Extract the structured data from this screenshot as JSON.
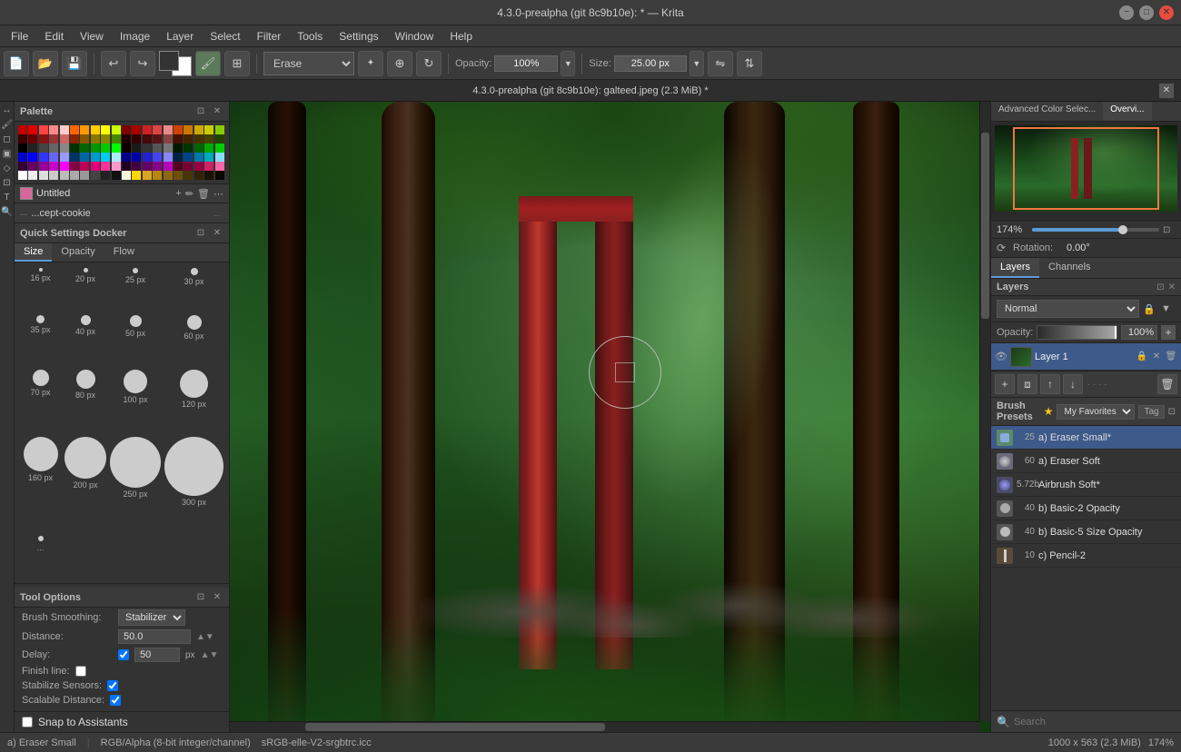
{
  "titlebar": {
    "title": "4.3.0-prealpha (git 8c9b10e):  * — Krita"
  },
  "menubar": {
    "items": [
      "File",
      "Edit",
      "View",
      "Image",
      "Layer",
      "Select",
      "Filter",
      "Tools",
      "Settings",
      "Window",
      "Help"
    ]
  },
  "toolbar": {
    "brush_mode": "Erase",
    "opacity_label": "Opacity:",
    "opacity_value": "100%",
    "size_label": "Size:",
    "size_value": "25.00 px"
  },
  "subheader": {
    "filename": "4.3.0-prealpha (git 8c9b10e): galteed.jpeg (2.3 MiB) *"
  },
  "left_panel": {
    "palette": {
      "title": "Palette",
      "colors": [
        "#c00000",
        "#e00000",
        "#ff4444",
        "#ff8888",
        "#ffcccc",
        "#ff6600",
        "#ff9900",
        "#ffcc00",
        "#ffff00",
        "#ccff00",
        "#800000",
        "#aa0000",
        "#cc2222",
        "#dd4444",
        "#ee8888",
        "#cc4400",
        "#cc7700",
        "#ccaa00",
        "#cccc00",
        "#88cc00",
        "#400000",
        "#660000",
        "#881111",
        "#993333",
        "#cc6666",
        "#882200",
        "#885500",
        "#887700",
        "#888800",
        "#448800",
        "#200000",
        "#330000",
        "#440808",
        "#551515",
        "#884444",
        "#441100",
        "#442200",
        "#443300",
        "#444400",
        "#224400",
        "#000000",
        "#222222",
        "#444444",
        "#666666",
        "#888888",
        "#003300",
        "#006600",
        "#009900",
        "#00cc00",
        "#00ff00",
        "#110000",
        "#1a1a1a",
        "#333333",
        "#555555",
        "#777777",
        "#001a00",
        "#003300",
        "#006600",
        "#00aa00",
        "#00cc00",
        "#0000cc",
        "#0000ff",
        "#3333ff",
        "#6666ff",
        "#9999ff",
        "#003366",
        "#0066aa",
        "#0099cc",
        "#00ccee",
        "#aaeeff",
        "#000088",
        "#0000aa",
        "#2222cc",
        "#4444ee",
        "#8888ff",
        "#002244",
        "#004488",
        "#0077aa",
        "#00aabb",
        "#88ddff",
        "#330033",
        "#660066",
        "#990099",
        "#cc00cc",
        "#ff00ff",
        "#880044",
        "#bb0055",
        "#dd0077",
        "#ff3399",
        "#ff99cc",
        "#220022",
        "#440044",
        "#660066",
        "#880088",
        "#bb00bb",
        "#550022",
        "#770033",
        "#990044",
        "#cc2266",
        "#ff66aa",
        "#ffffff",
        "#eeeeee",
        "#dddddd",
        "#cccccc",
        "#bbbbbb",
        "#aaaaaa",
        "#999999",
        "#444444",
        "#222222",
        "#111111",
        "#f5f5dc",
        "#ffd700",
        "#daa520",
        "#b8860b",
        "#8b6914",
        "#6b4f0a",
        "#4a3507",
        "#302208",
        "#1a1204",
        "#0a0800"
      ]
    },
    "layer": {
      "name": "Untitled",
      "color": "#d4689a"
    },
    "brush": {
      "name": "...cept-cookie",
      "hint": "..."
    },
    "quick_settings": {
      "title": "Quick Settings Docker",
      "tabs": [
        "Size",
        "Opacity",
        "Flow"
      ],
      "active_tab": "Size",
      "sizes": [
        {
          "px": "16 px",
          "size": 4
        },
        {
          "px": "20 px",
          "size": 5
        },
        {
          "px": "25 px",
          "size": 6
        },
        {
          "px": "30 px",
          "size": 8
        },
        {
          "px": "35 px",
          "size": 9
        },
        {
          "px": "40 px",
          "size": 11
        },
        {
          "px": "50 px",
          "size": 13
        },
        {
          "px": "60 px",
          "size": 16
        },
        {
          "px": "70 px",
          "size": 18
        },
        {
          "px": "80 px",
          "size": 21
        },
        {
          "px": "100 px",
          "size": 26
        },
        {
          "px": "120 px",
          "size": 31
        },
        {
          "px": "160 px",
          "size": 38
        },
        {
          "px": "200 px",
          "size": 46
        },
        {
          "px": "250 px",
          "size": 56
        },
        {
          "px": "300 px",
          "size": 65
        },
        {
          "px": "...",
          "size": 6
        }
      ]
    }
  },
  "tool_options": {
    "title": "Tool Options",
    "brush_smoothing_label": "Brush Smoothing:",
    "brush_smoothing_value": "Stabilizer",
    "distance_label": "Distance:",
    "distance_value": "50.0",
    "delay_label": "Delay:",
    "delay_value": "50",
    "delay_unit": "px",
    "finish_line_label": "Finish line:",
    "stabilize_sensors_label": "Stabilize Sensors:",
    "scalable_distance_label": "Scalable Distance:"
  },
  "snap": {
    "label": "Snap to Assistants"
  },
  "right_panel": {
    "top_tabs": [
      "Advanced Color Selec...",
      "Overvi..."
    ],
    "active_top_tab": "Overvi...",
    "overview": {
      "zoom_value": "174%"
    },
    "rotation": {
      "label": "Rotation:",
      "value": "0.00°"
    },
    "layers": {
      "title": "Layers",
      "tabs": [
        "Layers",
        "Channels"
      ],
      "active_tab": "Layers",
      "blend_mode": "Normal",
      "opacity_label": "Opacity:",
      "opacity_value": "100%",
      "items": [
        {
          "name": "Layer 1",
          "visible": true,
          "active": true
        }
      ]
    },
    "brush_presets": {
      "title": "Brush Presets",
      "favorites_label": "My Favorites",
      "tag_label": "Tag",
      "items": [
        {
          "number": "25",
          "name": "a) Eraser Small*",
          "active": true
        },
        {
          "number": "60",
          "name": "a) Eraser Soft",
          "active": false
        },
        {
          "number": "5.72b",
          "name": "Airbrush Soft*",
          "active": false
        },
        {
          "number": "40",
          "name": "b) Basic-2 Opacity",
          "active": false
        },
        {
          "number": "40",
          "name": "b) Basic-5 Size Opacity",
          "active": false
        },
        {
          "number": "10",
          "name": "c) Pencil-2",
          "active": false
        }
      ],
      "search_placeholder": "Search"
    }
  },
  "status_bar": {
    "brush_name": "a) Eraser Small",
    "color_mode": "RGB/Alpha (8-bit integer/channel)",
    "color_profile": "sRGB-elle-V2-srgbtrc.icc",
    "dimensions": "1000 x 563 (2.3 MiB)",
    "zoom": "174%"
  }
}
